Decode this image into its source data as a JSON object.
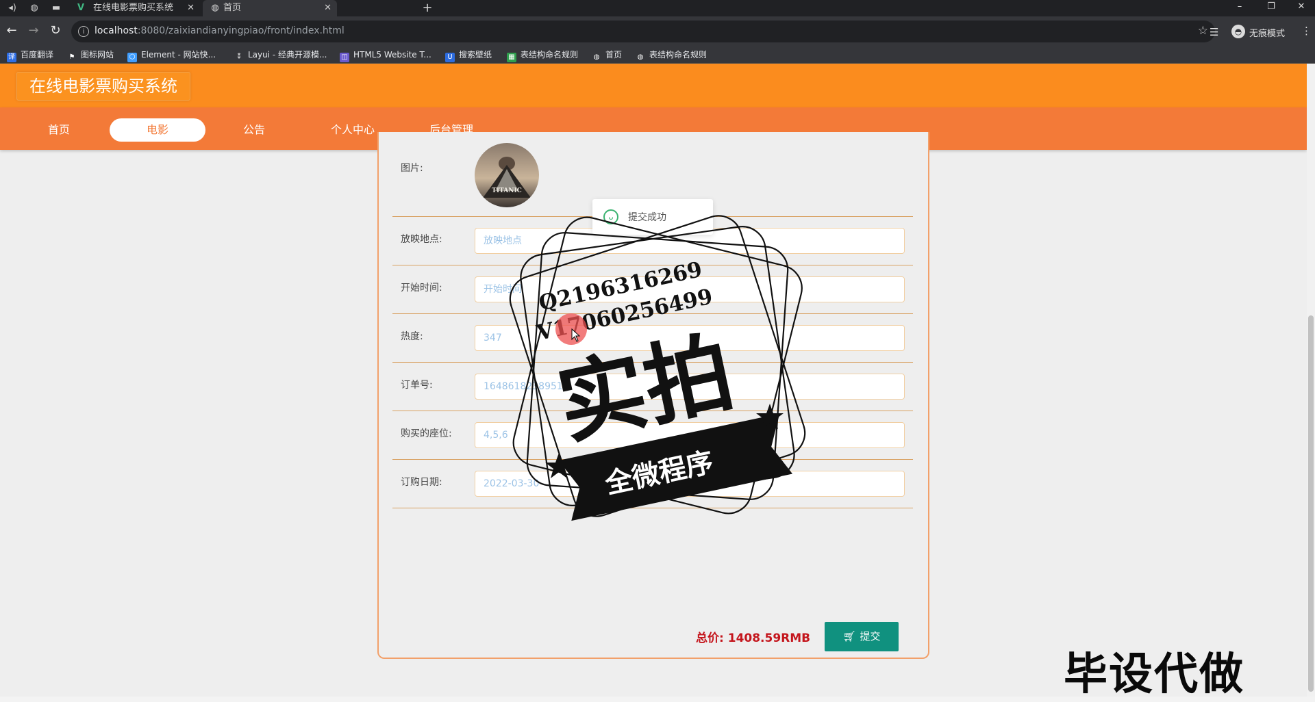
{
  "browser": {
    "tabs": [
      {
        "title": "在线电影票购买系统",
        "icon": "vue-logo-icon",
        "active": false
      },
      {
        "title": "首页",
        "icon": "globe-icon",
        "active": true
      }
    ],
    "url_host": "localhost",
    "url_rest": ":8080/zaixiandianyingpiao/front/index.html",
    "profile_label": "无痕模式",
    "bookmarks": [
      "百度翻译",
      "图标网站",
      "Element - 网站快...",
      "Layui - 经典开源模...",
      "HTML5 Website T...",
      "搜索壁纸",
      "表结构命名规则",
      "首页",
      "表结构命名规则"
    ]
  },
  "site": {
    "brand": "在线电影票购买系统",
    "nav": [
      "首页",
      "电影",
      "公告",
      "个人中心",
      "后台管理"
    ],
    "active_nav": 1
  },
  "form": {
    "image_label": "图片:",
    "fields": [
      {
        "label": "放映地点:",
        "value": "放映地点"
      },
      {
        "label": "开始时间:",
        "value": "开始时间"
      },
      {
        "label": "热度:",
        "value": "347"
      },
      {
        "label": "订单号:",
        "value": "1648618238951"
      },
      {
        "label": "购买的座位:",
        "value": "4,5,6"
      },
      {
        "label": "订购日期:",
        "value": "2022-03-30"
      }
    ],
    "poster_text": "TITANIC",
    "total_label": "总价:",
    "total_value": "1408.59RMB",
    "submit_label": "提交"
  },
  "toast": {
    "message": "提交成功"
  },
  "watermark": {
    "line1": "Q2196316269",
    "line2": "V17060256499",
    "main": "实拍",
    "banner": "全微程序",
    "corner": "毕设代做"
  },
  "colors": {
    "header": "#fb8c1e",
    "nav": "#f37a38",
    "submit": "#10917f",
    "total": "#c4151c"
  }
}
